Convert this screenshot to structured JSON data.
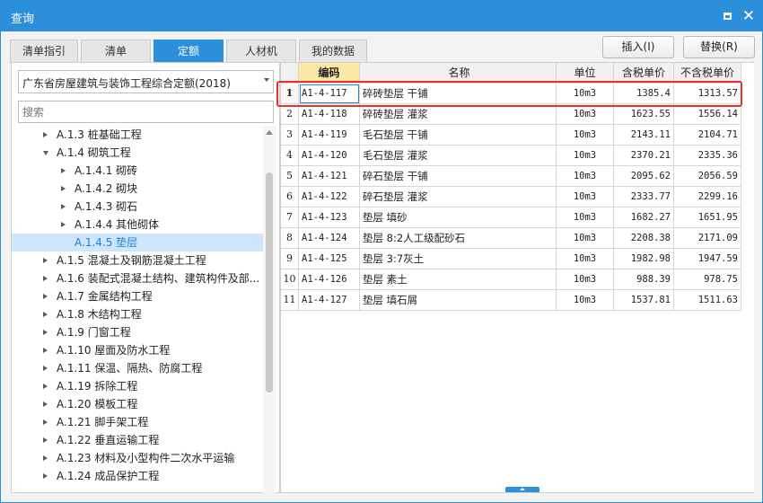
{
  "window": {
    "title": "查询"
  },
  "tabs": [
    {
      "label": "清单指引",
      "active": false
    },
    {
      "label": "清单",
      "active": false
    },
    {
      "label": "定额",
      "active": true
    },
    {
      "label": "人材机",
      "active": false
    },
    {
      "label": "我的数据",
      "active": false
    }
  ],
  "toolbar": {
    "insert_label": "插入(I)",
    "replace_label": "替换(R)"
  },
  "library": {
    "selected": "广东省房屋建筑与装饰工程综合定额(2018)"
  },
  "search": {
    "placeholder": "搜索"
  },
  "tree": [
    {
      "label": "A.1.3 桩基础工程",
      "level": 1,
      "expanded": false,
      "selected": false
    },
    {
      "label": "A.1.4 砌筑工程",
      "level": 1,
      "expanded": true,
      "selected": false
    },
    {
      "label": "A.1.4.1 砌砖",
      "level": 2,
      "expanded": false,
      "selected": false
    },
    {
      "label": "A.1.4.2 砌块",
      "level": 2,
      "expanded": false,
      "selected": false
    },
    {
      "label": "A.1.4.3 砌石",
      "level": 2,
      "expanded": false,
      "selected": false
    },
    {
      "label": "A.1.4.4 其他砌体",
      "level": 2,
      "expanded": false,
      "selected": false
    },
    {
      "label": "A.1.4.5 垫层",
      "level": 2,
      "leaf": true,
      "selected": true
    },
    {
      "label": "A.1.5 混凝土及钢筋混凝土工程",
      "level": 1,
      "expanded": false,
      "selected": false
    },
    {
      "label": "A.1.6 装配式混凝土结构、建筑构件及部...",
      "level": 1,
      "expanded": false,
      "selected": false
    },
    {
      "label": "A.1.7 金属结构工程",
      "level": 1,
      "expanded": false,
      "selected": false
    },
    {
      "label": "A.1.8 木结构工程",
      "level": 1,
      "expanded": false,
      "selected": false
    },
    {
      "label": "A.1.9 门窗工程",
      "level": 1,
      "expanded": false,
      "selected": false
    },
    {
      "label": "A.1.10 屋面及防水工程",
      "level": 1,
      "expanded": false,
      "selected": false
    },
    {
      "label": "A.1.11 保温、隔热、防腐工程",
      "level": 1,
      "expanded": false,
      "selected": false
    },
    {
      "label": "A.1.19 拆除工程",
      "level": 1,
      "expanded": false,
      "selected": false
    },
    {
      "label": "A.1.20 模板工程",
      "level": 1,
      "expanded": false,
      "selected": false
    },
    {
      "label": "A.1.21 脚手架工程",
      "level": 1,
      "expanded": false,
      "selected": false
    },
    {
      "label": "A.1.22 垂直运输工程",
      "level": 1,
      "expanded": false,
      "selected": false
    },
    {
      "label": "A.1.23 材料及小型构件二次水平运输",
      "level": 1,
      "expanded": false,
      "selected": false
    },
    {
      "label": "A.1.24 成品保护工程",
      "level": 1,
      "expanded": false,
      "selected": false
    }
  ],
  "grid": {
    "columns": [
      "",
      "编码",
      "名称",
      "单位",
      "含税单价",
      "不含税单价"
    ],
    "rows": [
      {
        "n": "1",
        "code": "A1-4-117",
        "name": "碎砖垫层 干铺",
        "unit": "10m3",
        "price_tax": "1385.4",
        "price_notax": "1313.57"
      },
      {
        "n": "2",
        "code": "A1-4-118",
        "name": "碎砖垫层 灌浆",
        "unit": "10m3",
        "price_tax": "1623.55",
        "price_notax": "1556.14"
      },
      {
        "n": "3",
        "code": "A1-4-119",
        "name": "毛石垫层 干铺",
        "unit": "10m3",
        "price_tax": "2143.11",
        "price_notax": "2104.71"
      },
      {
        "n": "4",
        "code": "A1-4-120",
        "name": "毛石垫层 灌浆",
        "unit": "10m3",
        "price_tax": "2370.21",
        "price_notax": "2335.36"
      },
      {
        "n": "5",
        "code": "A1-4-121",
        "name": "碎石垫层 干铺",
        "unit": "10m3",
        "price_tax": "2095.62",
        "price_notax": "2056.59"
      },
      {
        "n": "6",
        "code": "A1-4-122",
        "name": "碎石垫层 灌浆",
        "unit": "10m3",
        "price_tax": "2333.77",
        "price_notax": "2299.16"
      },
      {
        "n": "7",
        "code": "A1-4-123",
        "name": "垫层 填砂",
        "unit": "10m3",
        "price_tax": "1682.27",
        "price_notax": "1651.95"
      },
      {
        "n": "8",
        "code": "A1-4-124",
        "name": "垫层 8:2人工级配砂石",
        "unit": "10m3",
        "price_tax": "2208.38",
        "price_notax": "2171.09"
      },
      {
        "n": "9",
        "code": "A1-4-125",
        "name": "垫层 3:7灰土",
        "unit": "10m3",
        "price_tax": "1982.98",
        "price_notax": "1947.59"
      },
      {
        "n": "10",
        "code": "A1-4-126",
        "name": "垫层 素土",
        "unit": "10m3",
        "price_tax": "988.39",
        "price_notax": "978.75"
      },
      {
        "n": "11",
        "code": "A1-4-127",
        "name": "垫层 填石屑",
        "unit": "10m3",
        "price_tax": "1537.81",
        "price_notax": "1511.63"
      }
    ]
  },
  "colors": {
    "accent": "#2b8fdc",
    "selected_tree": "#cde6fb",
    "highlight": "#e5332b",
    "sorted_header": "#fbe8a6"
  }
}
